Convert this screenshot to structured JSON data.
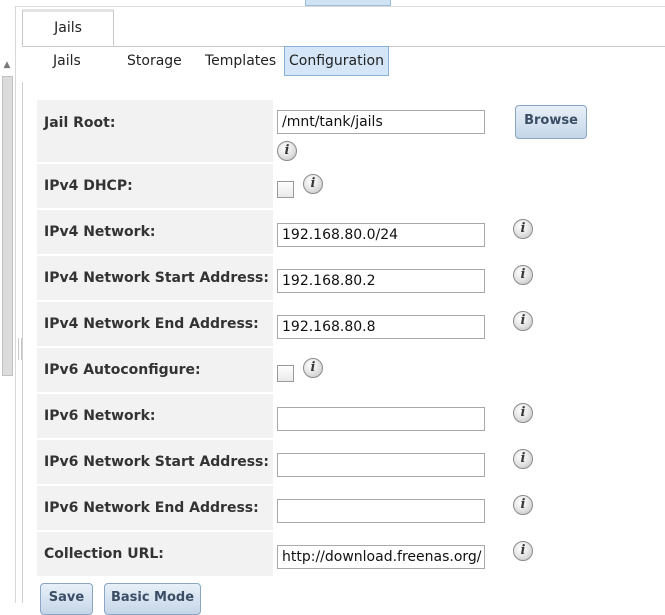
{
  "outer_tab": {
    "label": "Jails"
  },
  "inner_tabs": [
    {
      "label": "Jails",
      "active": false
    },
    {
      "label": "Storage",
      "active": false
    },
    {
      "label": "Templates",
      "active": false
    },
    {
      "label": "Configuration",
      "active": true
    }
  ],
  "form": {
    "jail_root": {
      "label": "Jail Root:",
      "value": "/mnt/tank/jails",
      "browse_label": "Browse"
    },
    "ipv4_dhcp": {
      "label": "IPv4 DHCP:",
      "checked": false
    },
    "ipv4_network": {
      "label": "IPv4 Network:",
      "value": "192.168.80.0/24"
    },
    "ipv4_start": {
      "label": "IPv4 Network Start Address:",
      "value": "192.168.80.2"
    },
    "ipv4_end": {
      "label": "IPv4 Network End Address:",
      "value": "192.168.80.8"
    },
    "ipv6_autoconf": {
      "label": "IPv6 Autoconfigure:",
      "checked": false
    },
    "ipv6_network": {
      "label": "IPv6 Network:",
      "value": ""
    },
    "ipv6_start": {
      "label": "IPv6 Network Start Address:",
      "value": ""
    },
    "ipv6_end": {
      "label": "IPv6 Network End Address:",
      "value": ""
    },
    "collection_url": {
      "label": "Collection URL:",
      "value": "http://download.freenas.org/"
    }
  },
  "actions": {
    "save_label": "Save",
    "basic_mode_label": "Basic Mode"
  },
  "icons": {
    "info": "info-icon",
    "info_glyph": "i"
  },
  "colors": {
    "active_tab_bg": "#d4e6f7",
    "label_bg": "#f2f2f2",
    "button_text": "#3b4e66"
  }
}
